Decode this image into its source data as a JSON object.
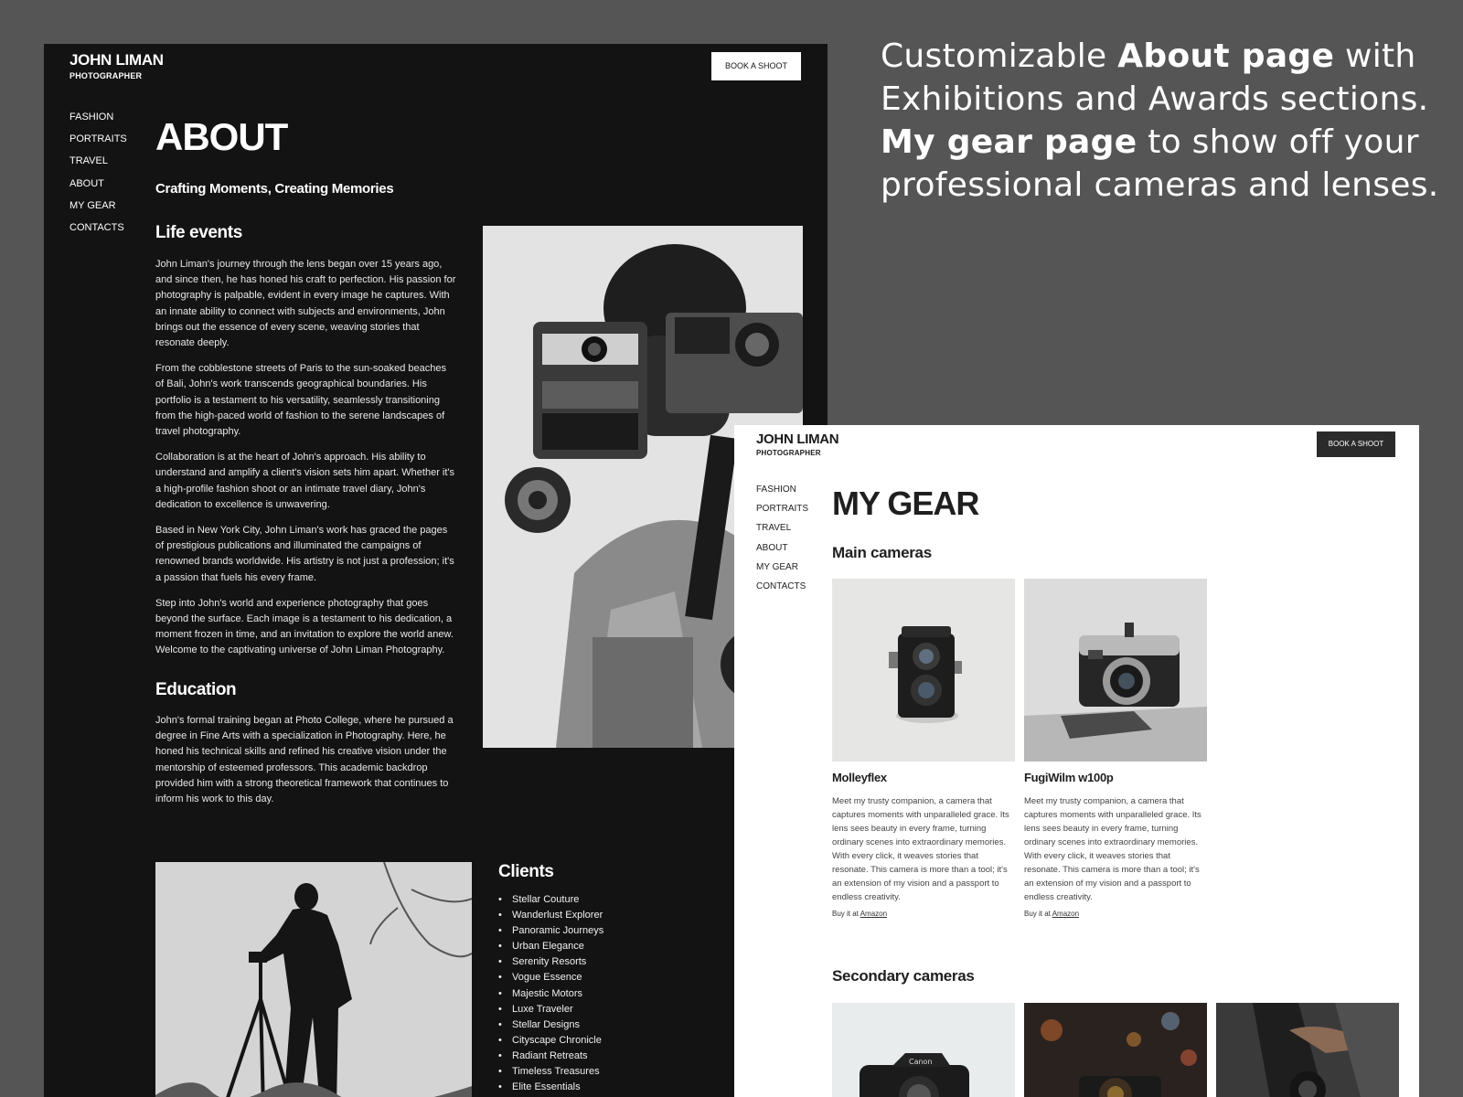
{
  "caption": {
    "part1": "Customizable ",
    "part1_bold": "About page",
    "part2": " with Exhibitions and Awards sections.",
    "part3_bold": "My gear page",
    "part4": " to show off your professional cameras and lenses."
  },
  "about_page": {
    "brand_name": "JOHN LIMAN",
    "brand_sub": "PHOTOGRAPHER",
    "book_label": "BOOK A SHOOT",
    "nav": [
      "FASHION",
      "PORTRAITS",
      "TRAVEL",
      "ABOUT",
      "MY GEAR",
      "CONTACTS"
    ],
    "title": "ABOUT",
    "tagline": "Crafting Moments, Creating Memories",
    "life_events_title": "Life events",
    "life_events": [
      "John Liman's journey through the lens began over 15 years ago, and since then, he has honed his craft to perfection. His passion for photography is palpable, evident in every image he captures. With an innate ability to connect with subjects and environments, John brings out the essence of every scene, weaving stories that resonate deeply.",
      "From the cobblestone streets of Paris to the sun-soaked beaches of Bali, John's work transcends geographical boundaries. His portfolio is a testament to his versatility, seamlessly transitioning from the high-paced world of fashion to the serene landscapes of travel photography.",
      "Collaboration is at the heart of John's approach. His ability to understand and amplify a client's vision sets him apart. Whether it's a high-profile fashion shoot or an intimate travel diary, John's dedication to excellence is unwavering.",
      "Based in New York City, John Liman's work has graced the pages of prestigious publications and illuminated the campaigns of renowned brands worldwide. His artistry is not just a profession; it's a passion that fuels his every frame.",
      "Step into John's world and experience photography that goes beyond the surface. Each image is a testament to his dedication, a moment frozen in time, and an invitation to explore the world anew. Welcome to the captivating universe of John Liman Photography."
    ],
    "education_title": "Education",
    "education": "John's formal training began at Photo College, where he pursued a degree in Fine Arts with a specialization in Photography. Here, he honed his technical skills and refined his creative vision under the mentorship of esteemed professors. This academic backdrop provided him with a strong theoretical framework that continues to inform his work to this day.",
    "clients_title": "Clients",
    "clients": [
      "Stellar Couture",
      "Wanderlust Explorer",
      "Panoramic Journeys",
      "Urban Elegance",
      "Serenity Resorts",
      "Vogue Essence",
      "Majestic Motors",
      "Luxe Traveler",
      "Stellar Designs",
      "Cityscape Chronicle",
      "Radiant Retreats",
      "Timeless Treasures",
      "Elite Essentials"
    ]
  },
  "gear_page": {
    "brand_name": "JOHN LIMAN",
    "brand_sub": "PHOTOGRAPHER",
    "book_label": "BOOK A SHOOT",
    "nav": [
      "FASHION",
      "PORTRAITS",
      "TRAVEL",
      "ABOUT",
      "MY GEAR",
      "CONTACTS"
    ],
    "title": "MY GEAR",
    "main_title": "Main cameras",
    "cameras": [
      {
        "name": "Molleyflex",
        "desc": "Meet my trusty companion, a camera that captures moments with unparalleled grace. Its lens sees beauty in every frame, turning ordinary scenes into extraordinary memories. With every click, it weaves stories that resonate. This camera is more than a tool; it's an extension of my vision and a passport to endless creativity.",
        "buy_prefix": "Buy it at ",
        "buy_link": "Amazon"
      },
      {
        "name": "FugiWilm w100p",
        "desc": "Meet my trusty companion, a camera that captures moments with unparalleled grace. Its lens sees beauty in every frame, turning ordinary scenes into extraordinary memories. With every click, it weaves stories that resonate. This camera is more than a tool; it's an extension of my vision and a passport to endless creativity.",
        "buy_prefix": "Buy it at ",
        "buy_link": "Amazon"
      }
    ],
    "secondary_title": "Secondary cameras",
    "canon_label": "Canon"
  },
  "colors": {
    "page_bg": "#555555",
    "dark_bg": "#131313",
    "light_bg": "#ffffff",
    "accent_dark": "#2b2b2b"
  }
}
